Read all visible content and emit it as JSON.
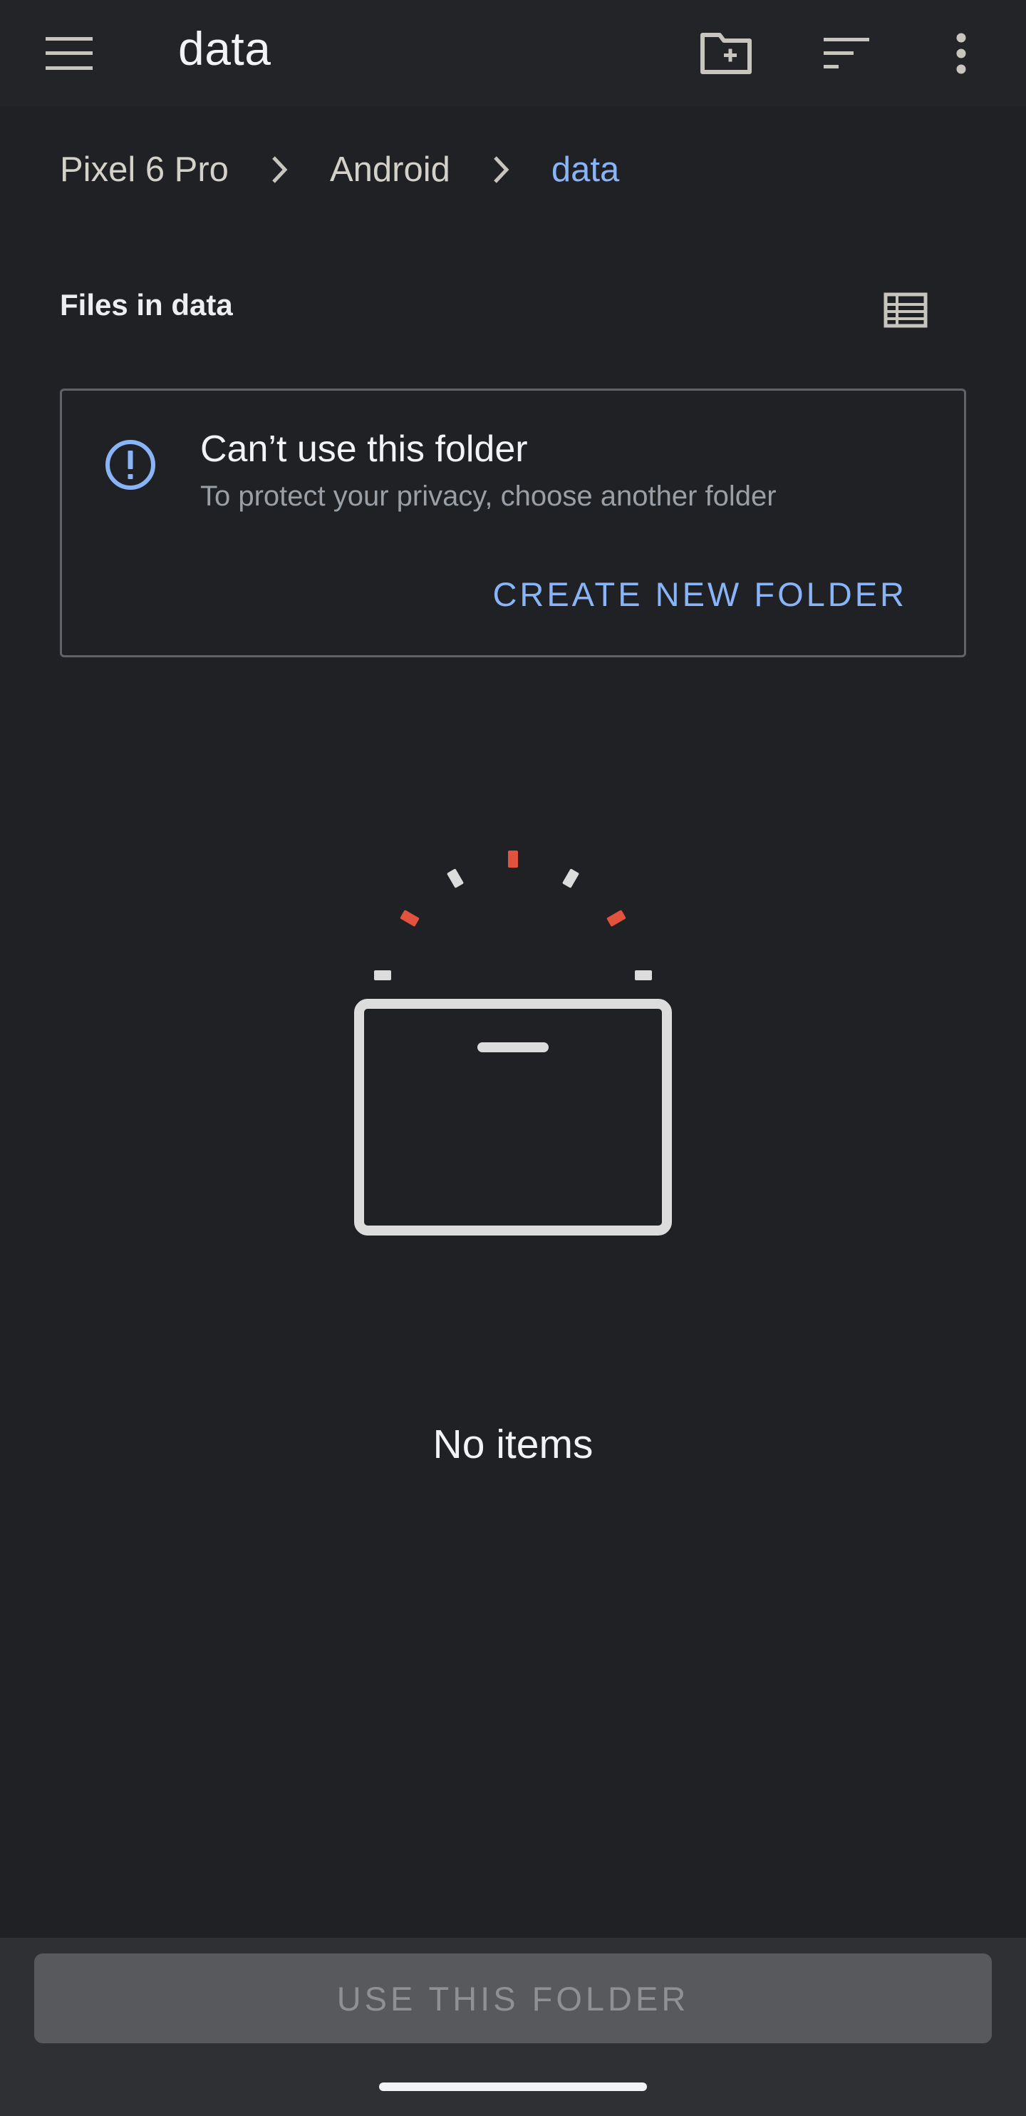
{
  "app_bar": {
    "title": "data",
    "icons": {
      "menu": "hamburger-menu-icon",
      "new_folder": "new-folder-icon",
      "sort": "sort-icon",
      "more": "more-vert-icon"
    }
  },
  "breadcrumb": {
    "items": [
      {
        "label": "Pixel 6 Pro"
      },
      {
        "label": "Android"
      },
      {
        "label": "data"
      }
    ],
    "separator_icon": "chevron-right-icon"
  },
  "section": {
    "title": "Files in data",
    "view_toggle_icon": "list-view-icon"
  },
  "warning": {
    "icon": "info-alert-icon",
    "title": "Can’t use this folder",
    "subtitle": "To protect your privacy, choose another folder",
    "action_label": "CREATE NEW FOLDER"
  },
  "empty_state": {
    "illustration": "empty-box-illustration",
    "message": "No items"
  },
  "bottom": {
    "use_folder_label": "USE THIS FOLDER"
  },
  "colors": {
    "background": "#202124",
    "accent": "#8ab4f8",
    "alert_red": "#e2533f"
  }
}
